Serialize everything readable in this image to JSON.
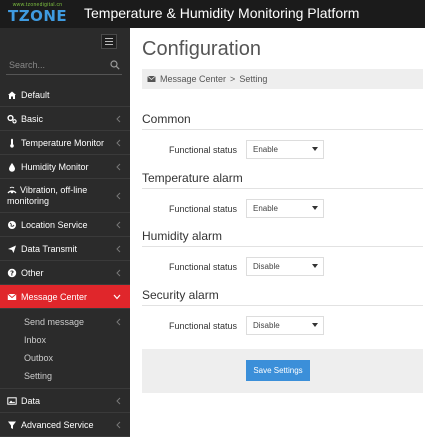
{
  "header": {
    "logo_tagline": "www.tzonedigital.cn",
    "logo_text": "TZONE",
    "title": "Temperature & Humidity Monitoring Platform"
  },
  "sidebar": {
    "search_placeholder": "Search...",
    "items": [
      {
        "label": "Default",
        "icon": "home-icon"
      },
      {
        "label": "Basic",
        "icon": "cogs-icon"
      },
      {
        "label": "Temperature Monitor",
        "icon": "thermometer-icon"
      },
      {
        "label": "Humidity Monitor",
        "icon": "droplet-icon"
      },
      {
        "label": "Vibration, off-line monitoring",
        "icon": "vibration-icon"
      },
      {
        "label": "Location Service",
        "icon": "globe-icon"
      },
      {
        "label": "Data Transmit",
        "icon": "send-icon"
      },
      {
        "label": "Other",
        "icon": "question-icon"
      },
      {
        "label": "Message Center",
        "icon": "envelope-icon"
      },
      {
        "label": "Data",
        "icon": "image-icon"
      },
      {
        "label": "Advanced Service",
        "icon": "filter-icon"
      }
    ],
    "submenu": [
      "Send message",
      "Inbox",
      "Outbox",
      "Setting"
    ]
  },
  "main": {
    "page_title": "Configuration",
    "breadcrumb": {
      "parent": "Message Center",
      "separator": ">",
      "current": "Setting"
    },
    "sections": [
      {
        "title": "Common",
        "field_label": "Functional status",
        "value": "Enable"
      },
      {
        "title": "Temperature alarm",
        "field_label": "Functional status",
        "value": "Enable"
      },
      {
        "title": "Humidity alarm",
        "field_label": "Functional status",
        "value": "Disable"
      },
      {
        "title": "Security alarm",
        "field_label": "Functional status",
        "value": "Disable"
      }
    ],
    "save_label": "Save Settings"
  },
  "colors": {
    "header_bg": "#1b1b1b",
    "sidebar_bg": "#2b2b2b",
    "active_item": "#e0262b",
    "save_button": "#3b8fd9"
  }
}
